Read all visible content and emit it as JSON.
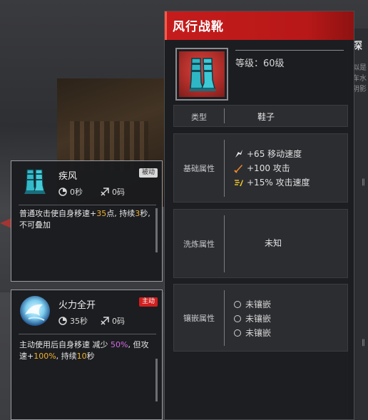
{
  "item": {
    "name": "风行战靴",
    "level_text": "等级：60级",
    "icon": "boots-icon",
    "rows": {
      "type": {
        "label": "类型",
        "value": "鞋子"
      },
      "base": {
        "label": "基础属性",
        "stats": [
          {
            "icon": "speed-icon",
            "color": "#e8e8e8",
            "text": "+65 移动速度"
          },
          {
            "icon": "attack-icon",
            "color": "#f08a2a",
            "text": "+100 攻击"
          },
          {
            "icon": "attack-speed-icon",
            "color": "#e6c02a",
            "text": "+15% 攻击速度"
          }
        ]
      },
      "refine": {
        "label": "洗炼属性",
        "value": "未知"
      },
      "socket": {
        "label": "镶嵌属性",
        "slots": [
          "未镶嵌",
          "未镶嵌",
          "未镶嵌"
        ]
      }
    }
  },
  "skills": [
    {
      "name": "疾风",
      "badge": "被动",
      "cooldown": "0秒",
      "cost": "0码",
      "icon": "passive-boots-icon",
      "desc_parts": [
        {
          "t": "普通攻击使自身移速+",
          "c": ""
        },
        {
          "t": "35",
          "c": "y"
        },
        {
          "t": "点, 持续",
          "c": ""
        },
        {
          "t": "3",
          "c": "y"
        },
        {
          "t": "秒, 不可叠加",
          "c": ""
        }
      ]
    },
    {
      "name": "火力全开",
      "badge": "主动",
      "cooldown": "35秒",
      "cost": "0码",
      "icon": "active-skill-icon",
      "desc_parts": [
        {
          "t": "主动使用后自身移速 减少 ",
          "c": ""
        },
        {
          "t": "50%",
          "c": "p"
        },
        {
          "t": ", 但攻速+",
          "c": ""
        },
        {
          "t": "100%",
          "c": "y"
        },
        {
          "t": ", 持续",
          "c": ""
        },
        {
          "t": "10",
          "c": "y"
        },
        {
          "t": "秒",
          "c": ""
        }
      ]
    }
  ],
  "background": {
    "right_title": "深",
    "right_lines": [
      "似是",
      "车水",
      "阴影"
    ]
  },
  "colors": {
    "header_red": "#c51c1c",
    "highlight_yellow": "#f0b32e",
    "highlight_purple": "#d06ae6"
  }
}
